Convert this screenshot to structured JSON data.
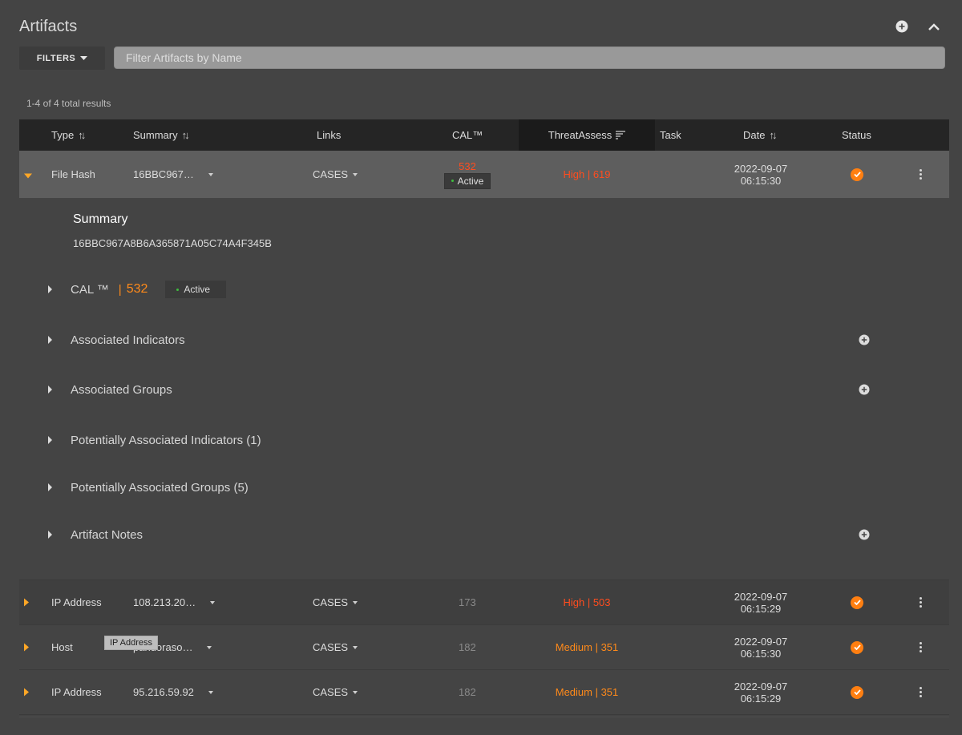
{
  "header": {
    "title": "Artifacts",
    "add_icon": "plus-circle-icon",
    "collapse_icon": "chevron-up-icon"
  },
  "toolbar": {
    "filters_label": "FILTERS",
    "search_placeholder": "Filter Artifacts by Name",
    "search_value": ""
  },
  "results": {
    "count_text": "1-4 of 4 total results"
  },
  "table": {
    "columns": {
      "type": "Type",
      "summary": "Summary",
      "links": "Links",
      "cal": "CAL™",
      "threat": "ThreatAssess",
      "task": "Task",
      "date": "Date",
      "status": "Status"
    },
    "rows": [
      {
        "type": "File Hash",
        "summary": "16BBC967…",
        "links": "CASES",
        "cal": "532",
        "cal_badge": "Active",
        "threat": "High | 619",
        "threat_level": "high",
        "date": "2022-09-07",
        "time": "06:15:30",
        "status": "checked",
        "expanded": true
      },
      {
        "type": "IP Address",
        "summary": "108.213.20…",
        "links": "CASES",
        "cal": "173",
        "threat": "High | 503",
        "threat_level": "high",
        "date": "2022-09-07",
        "time": "06:15:29",
        "status": "checked"
      },
      {
        "type": "Host",
        "summary": "pandoraso…",
        "links": "CASES",
        "cal": "182",
        "threat": "Medium | 351",
        "threat_level": "medium",
        "date": "2022-09-07",
        "time": "06:15:30",
        "status": "checked"
      },
      {
        "type": "IP Address",
        "summary": "95.216.59.92",
        "links": "CASES",
        "cal": "182",
        "threat": "Medium | 351",
        "threat_level": "medium",
        "date": "2022-09-07",
        "time": "06:15:29",
        "status": "checked"
      }
    ]
  },
  "detail": {
    "summary_heading": "Summary",
    "summary_value": "16BBC967A8B6A365871A05C74A4F345B",
    "cal_label": "CAL ™",
    "cal_separator": "|",
    "cal_value": "532",
    "cal_badge": "Active",
    "sections": [
      "Associated Indicators",
      "Associated Groups",
      "Potentially Associated Indicators (1)",
      "Potentially Associated Groups (5)",
      "Artifact Notes"
    ]
  },
  "tooltip": {
    "text": "IP Address"
  },
  "colors": {
    "accent_orange": "#ff7f11",
    "threat_high": "#ff4d1f",
    "threat_medium": "#ff8a1a",
    "active_green": "#3fbf3f",
    "background": "#444444",
    "header_bg": "#252525"
  }
}
